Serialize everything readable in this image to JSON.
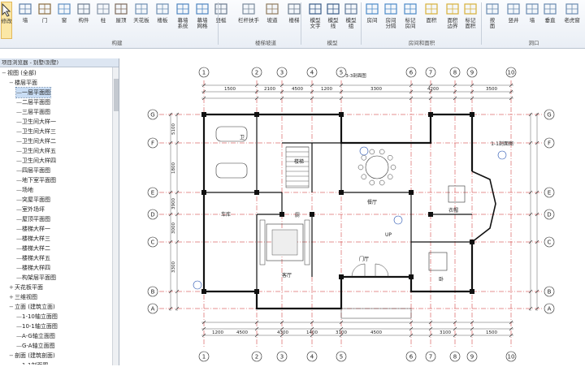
{
  "ribbon": {
    "modify": "修改",
    "buttons": [
      {
        "label": "墙",
        "icon": "wall-icon"
      },
      {
        "label": "门",
        "icon": "door-icon"
      },
      {
        "label": "窗",
        "icon": "window-icon"
      },
      {
        "label": "构件",
        "icon": "component-icon"
      },
      {
        "label": "柱",
        "icon": "column-icon"
      },
      {
        "label": "屋顶",
        "icon": "roof-icon"
      },
      {
        "label": "天花板",
        "icon": "ceiling-icon"
      },
      {
        "label": "楼板",
        "icon": "floor-icon"
      },
      {
        "label": "幕墙\n系统",
        "icon": "curtain-system-icon"
      },
      {
        "label": "幕墙\n网格",
        "icon": "curtain-grid-icon"
      },
      {
        "label": "竖梃",
        "icon": "mullion-icon"
      },
      {
        "label": "栏杆扶手",
        "icon": "railing-icon"
      },
      {
        "label": "坡道",
        "icon": "ramp-icon"
      },
      {
        "label": "楼梯",
        "icon": "stair-icon"
      },
      {
        "label": "模型\n文字",
        "icon": "model-text-icon"
      },
      {
        "label": "模型\n线",
        "icon": "model-line-icon"
      },
      {
        "label": "模型\n组",
        "icon": "model-group-icon"
      },
      {
        "label": "房间",
        "icon": "room-icon"
      },
      {
        "label": "房间\n分隔",
        "icon": "room-separator-icon"
      },
      {
        "label": "标记\n房间",
        "icon": "tag-room-icon"
      },
      {
        "label": "面积",
        "icon": "area-icon"
      },
      {
        "label": "面积\n边界",
        "icon": "area-boundary-icon"
      },
      {
        "label": "标记\n面积",
        "icon": "tag-area-icon"
      },
      {
        "label": "按\n面",
        "icon": "by-face-icon"
      },
      {
        "label": "竖井",
        "icon": "shaft-icon"
      },
      {
        "label": "墙",
        "icon": "opening-wall-icon"
      },
      {
        "label": "垂直",
        "icon": "vertical-opening-icon"
      },
      {
        "label": "老虎窗",
        "icon": "dormer-icon"
      }
    ],
    "groups": [
      "构建",
      "楼梯坡道",
      "模型",
      "房间和面积",
      "洞口"
    ]
  },
  "browser": {
    "title": "项目浏览器 - 别墅(别墅)",
    "items": [
      {
        "label": "视图 (全部)",
        "level": 0,
        "toggle": "−"
      },
      {
        "label": "楼层平面",
        "level": 1,
        "toggle": "−"
      },
      {
        "label": "一层平面图",
        "level": 2,
        "selected": true
      },
      {
        "label": "二层平面图",
        "level": 2
      },
      {
        "label": "三层平面图",
        "level": 2
      },
      {
        "label": "卫生间大样一",
        "level": 2
      },
      {
        "label": "卫生间大样三",
        "level": 2
      },
      {
        "label": "卫生间大样二",
        "level": 2
      },
      {
        "label": "卫生间大样五",
        "level": 2
      },
      {
        "label": "卫生间大样四",
        "level": 2
      },
      {
        "label": "四层平面图",
        "level": 2
      },
      {
        "label": "地下室平面图",
        "level": 2
      },
      {
        "label": "场地",
        "level": 2
      },
      {
        "label": "突屋平面图",
        "level": 2
      },
      {
        "label": "室外场坪",
        "level": 2
      },
      {
        "label": "屋顶平面图",
        "level": 2
      },
      {
        "label": "楼梯大样一",
        "level": 2
      },
      {
        "label": "楼梯大样三",
        "level": 2
      },
      {
        "label": "楼梯大样二",
        "level": 2
      },
      {
        "label": "楼梯大样五",
        "level": 2
      },
      {
        "label": "楼梯大样四",
        "level": 2
      },
      {
        "label": "构架层平面图",
        "level": 2
      },
      {
        "label": "天花板平面",
        "level": 1,
        "toggle": "+"
      },
      {
        "label": "三维视图",
        "level": 1,
        "toggle": "+"
      },
      {
        "label": "立面 (建筑立面)",
        "level": 1,
        "toggle": "−"
      },
      {
        "label": "1-10轴立面图",
        "level": 2
      },
      {
        "label": "10-1轴立面图",
        "level": 2
      },
      {
        "label": "A-G轴立面图",
        "level": 2
      },
      {
        "label": "G-A轴立面图",
        "level": 2
      },
      {
        "label": "剖面 (建筑剖面)",
        "level": 1,
        "toggle": "−"
      },
      {
        "label": "1-1剖面图",
        "level": 2
      }
    ]
  },
  "drawing": {
    "cols": [
      "1",
      "2",
      "3",
      "4",
      "5",
      "6",
      "7",
      "8",
      "9",
      "10"
    ],
    "rows": [
      "G",
      "F",
      "E",
      "D",
      "C",
      "B",
      "A"
    ],
    "top_dims": [
      "1500",
      "2100",
      "4500",
      "1200",
      "3300",
      "4200",
      "3500"
    ],
    "top_total": "3-3剖面图",
    "bottom_dims": [
      "1200",
      "4500",
      "4300",
      "1400",
      "3100",
      "4500",
      "3100",
      "1500"
    ],
    "side_dims": [
      "5100",
      "1800",
      "3900",
      "3000",
      "3300"
    ],
    "labels": [
      "1-1剖面图",
      "卫",
      "厨",
      "车库",
      "客厅",
      "餐厅",
      "衣帽",
      "楼梯",
      "门厅",
      "卧",
      "UP"
    ]
  }
}
